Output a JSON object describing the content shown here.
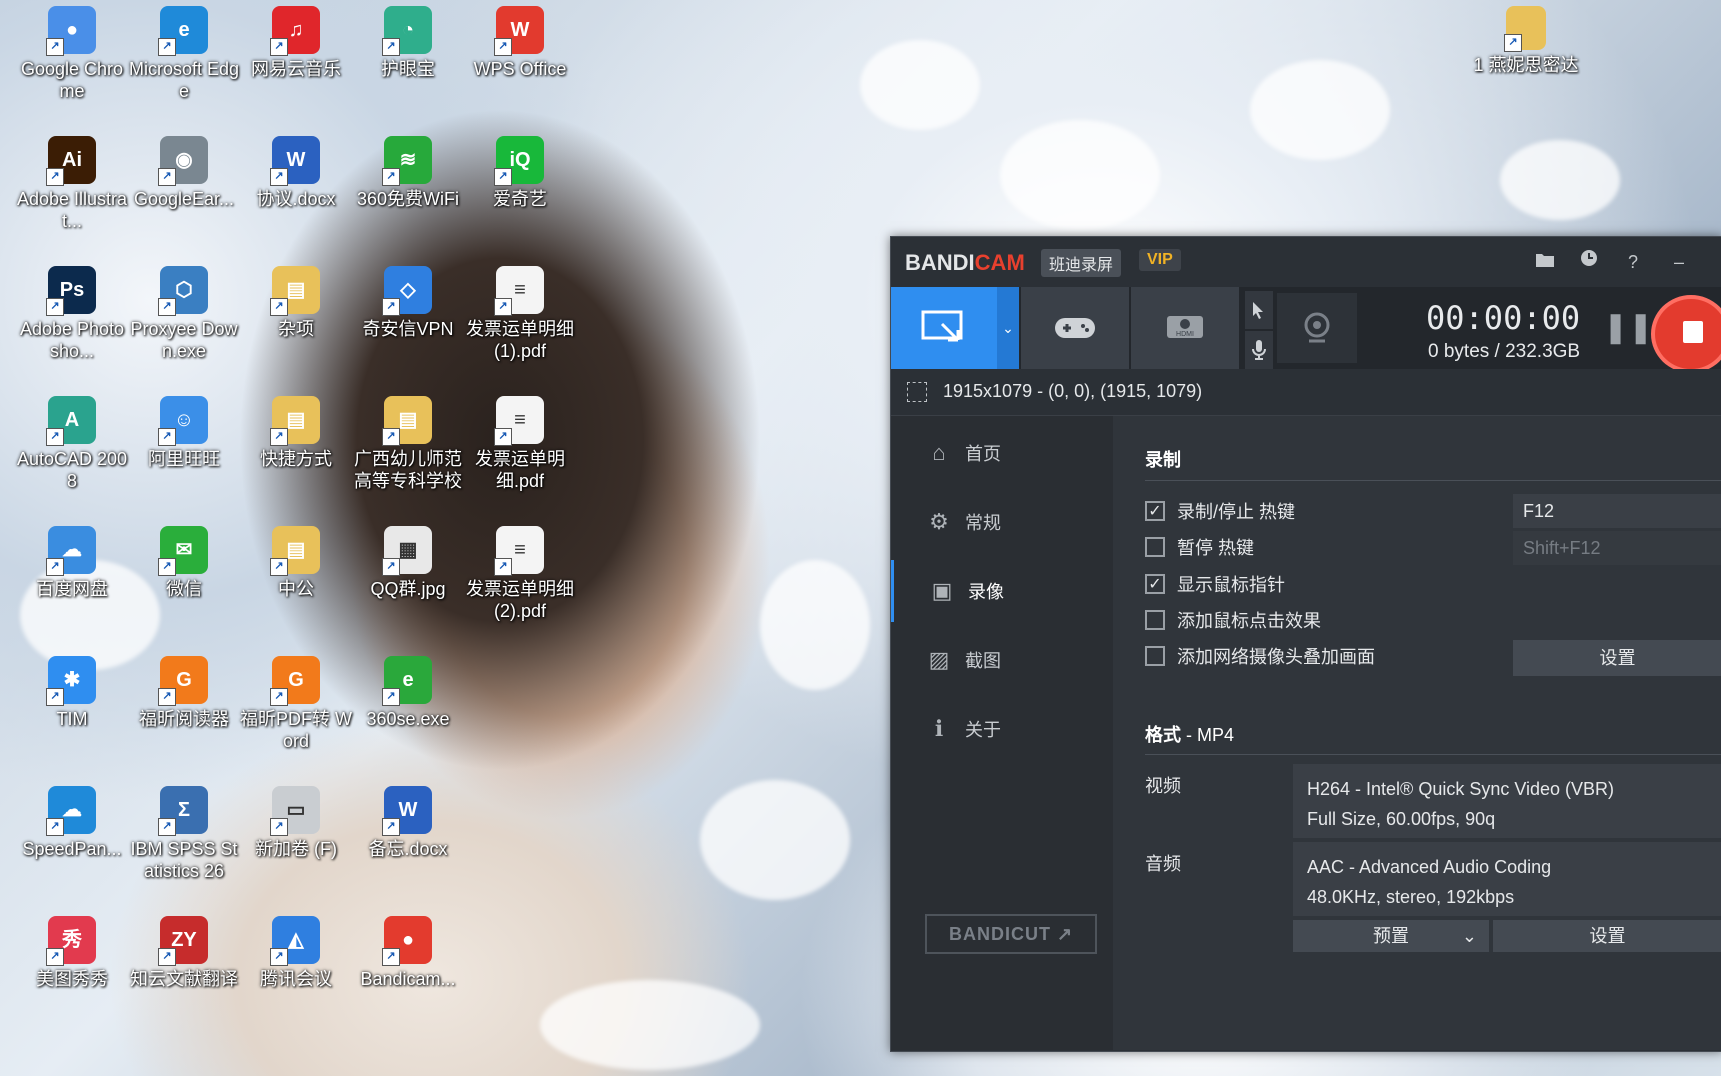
{
  "desktop": {
    "icons": [
      {
        "label": "Google Chrome",
        "color": "#4a8fe8",
        "glyph": "●"
      },
      {
        "label": "Microsoft Edge",
        "color": "#1f8ad9",
        "glyph": "e"
      },
      {
        "label": "网易云音乐",
        "color": "#e0262b",
        "glyph": "♫"
      },
      {
        "label": "护眼宝",
        "color": "#2fae8c",
        "glyph": "◔"
      },
      {
        "label": "WPS Office",
        "color": "#e23a2e",
        "glyph": "W"
      },
      {
        "label": "Adobe Illustrat...",
        "color": "#3b1d05",
        "glyph": "Ai"
      },
      {
        "label": "GoogleEar...",
        "color": "#7a8791",
        "glyph": "◉"
      },
      {
        "label": "协议.docx",
        "color": "#2b61c0",
        "glyph": "W"
      },
      {
        "label": "360免费WiFi",
        "color": "#27a93b",
        "glyph": "≋"
      },
      {
        "label": "爱奇艺",
        "color": "#18b83a",
        "glyph": "iQ"
      },
      {
        "label": "Adobe Photosho...",
        "color": "#0c2a4d",
        "glyph": "Ps"
      },
      {
        "label": "Proxyee Down.exe",
        "color": "#3a7fc2",
        "glyph": "⬡"
      },
      {
        "label": "杂项",
        "color": "#e8c15a",
        "glyph": "▤"
      },
      {
        "label": "奇安信VPN",
        "color": "#2f7fe0",
        "glyph": "◇"
      },
      {
        "label": "发票运单明细 (1).pdf",
        "color": "#f4f4f4",
        "glyph": "≡"
      },
      {
        "label": "AutoCAD 2008",
        "color": "#2aa38e",
        "glyph": "A"
      },
      {
        "label": "阿里旺旺",
        "color": "#3b8fe8",
        "glyph": "☺"
      },
      {
        "label": "快捷方式",
        "color": "#e8c15a",
        "glyph": "▤"
      },
      {
        "label": "广西幼儿师范高等专科学校",
        "color": "#e8c15a",
        "glyph": "▤"
      },
      {
        "label": "发票运单明细.pdf",
        "color": "#f4f4f4",
        "glyph": "≡"
      },
      {
        "label": "百度网盘",
        "color": "#3a8de0",
        "glyph": "☁"
      },
      {
        "label": "微信",
        "color": "#2aae3b",
        "glyph": "✉"
      },
      {
        "label": "中公",
        "color": "#e8c15a",
        "glyph": "▤"
      },
      {
        "label": "QQ群.jpg",
        "color": "#e8e8e8",
        "glyph": "▦"
      },
      {
        "label": "发票运单明细 (2).pdf",
        "color": "#f4f4f4",
        "glyph": "≡"
      },
      {
        "label": "TIM",
        "color": "#2f8ef0",
        "glyph": "✱"
      },
      {
        "label": "福昕阅读器",
        "color": "#f27a1b",
        "glyph": "G"
      },
      {
        "label": "福昕PDF转 Word",
        "color": "#f27a1b",
        "glyph": "G"
      },
      {
        "label": "360se.exe",
        "color": "#2aa83b",
        "glyph": "e"
      },
      {
        "label": "",
        "color": "",
        "glyph": ""
      },
      {
        "label": "SpeedPan...",
        "color": "#1f8ad9",
        "glyph": "☁"
      },
      {
        "label": "IBM SPSS Statistics 26",
        "color": "#3a6fb0",
        "glyph": "Σ"
      },
      {
        "label": "新加卷 (F)",
        "color": "#c9cdd1",
        "glyph": "▭"
      },
      {
        "label": "备忘.docx",
        "color": "#2b61c0",
        "glyph": "W"
      },
      {
        "label": "",
        "color": "",
        "glyph": ""
      },
      {
        "label": "美图秀秀",
        "color": "#e23a4e",
        "glyph": "秀"
      },
      {
        "label": "知云文献翻译",
        "color": "#c62c2c",
        "glyph": "ZY"
      },
      {
        "label": "腾讯会议",
        "color": "#2f7fe0",
        "glyph": "◭"
      },
      {
        "label": "Bandicam...",
        "color": "#e33b2e",
        "glyph": "●"
      }
    ],
    "top_right_icon": {
      "label": "1 燕妮思密达",
      "color": "#e8c15a",
      "glyph": "▤"
    }
  },
  "bandicam": {
    "logo_bandi": "BANDI",
    "logo_cam": "CAM",
    "cn_name": "班迪录屏",
    "vip": "VIP",
    "timer": "00:00:00",
    "filesize": "0 bytes / 232.3GB",
    "area_text": "1915x1079 - (0, 0), (1915, 1079)",
    "nav": [
      {
        "label": "首页",
        "icon": "home-icon",
        "glyph": "⌂"
      },
      {
        "label": "常规",
        "icon": "gear-icon",
        "glyph": "⚙"
      },
      {
        "label": "录像",
        "icon": "video-settings-icon",
        "glyph": "▣"
      },
      {
        "label": "截图",
        "icon": "screenshot-settings-icon",
        "glyph": "▨"
      },
      {
        "label": "关于",
        "icon": "info-icon",
        "glyph": "ℹ"
      }
    ],
    "bandicut_label": "BANDICUT ↗",
    "record_section": {
      "title": "录制",
      "options": [
        {
          "label": "录制/停止 热键",
          "checked": true,
          "mark": "✓"
        },
        {
          "label": "暂停 热键",
          "checked": false,
          "mark": ""
        },
        {
          "label": "显示鼠标指针",
          "checked": true,
          "mark": "✓"
        },
        {
          "label": "添加鼠标点击效果",
          "checked": false,
          "mark": ""
        },
        {
          "label": "添加网络摄像头叠加画面",
          "checked": false,
          "mark": ""
        }
      ],
      "hotkey_record": "F12",
      "hotkey_pause": "Shift+F12",
      "webcam_settings_btn": "设置"
    },
    "format_section": {
      "title": "格式",
      "format_value": " - MP4",
      "video_label": "视频",
      "video_line1": "H264 - Intel® Quick Sync Video (VBR)",
      "video_line2": "Full Size, 60.00fps, 90q",
      "audio_label": "音频",
      "audio_line1": "AAC - Advanced Audio Coding",
      "audio_line2": "48.0KHz, stereo, 192kbps",
      "preset_btn": "预置",
      "settings_btn": "设置"
    },
    "colors": {
      "accent": "#2f8ef0",
      "record": "#e33b2e",
      "vip": "#f0b225"
    }
  }
}
